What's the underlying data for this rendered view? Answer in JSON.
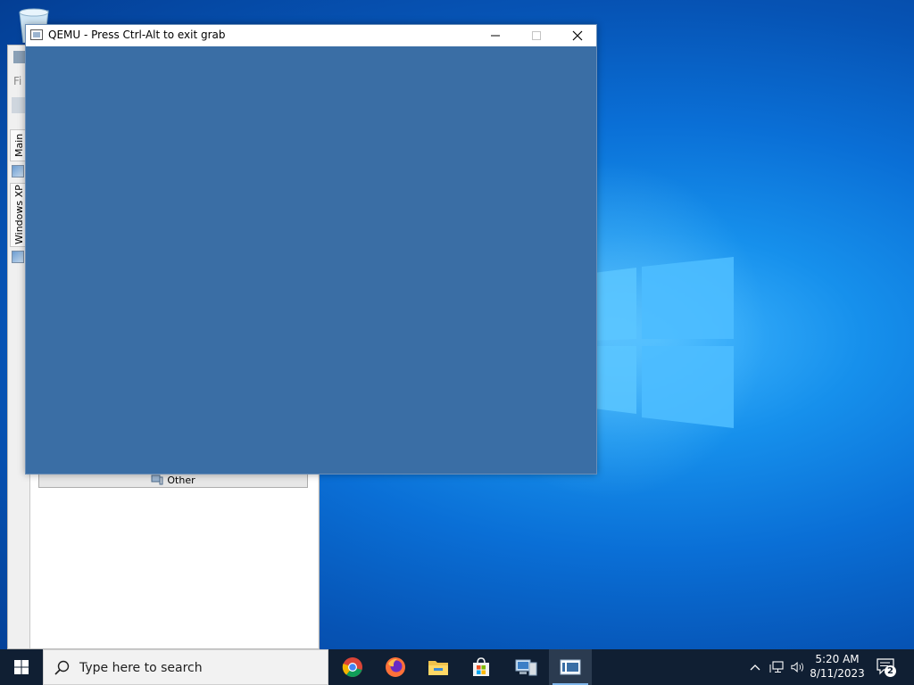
{
  "qemu_window": {
    "title": "QEMU - Press Ctrl-Alt to exit grab",
    "screen_color": "#3a6ea5"
  },
  "background_window": {
    "menu_fragment": "Fi",
    "vertical_tabs": [
      "Main",
      "Windows XP"
    ],
    "other_button_label": "Other"
  },
  "taskbar": {
    "search_placeholder": "Type here to search",
    "pinned_apps": [
      "chrome-icon",
      "firefox-icon",
      "file-explorer-icon",
      "microsoft-store-icon",
      "remote-desktop-icon",
      "qemu-app-icon"
    ],
    "clock_time": "5:20 AM",
    "clock_date": "8/11/2023",
    "notification_count": "2"
  },
  "colors": {
    "taskbar_bg": "#101f33",
    "desktop_accent": "#0a6fd6"
  }
}
